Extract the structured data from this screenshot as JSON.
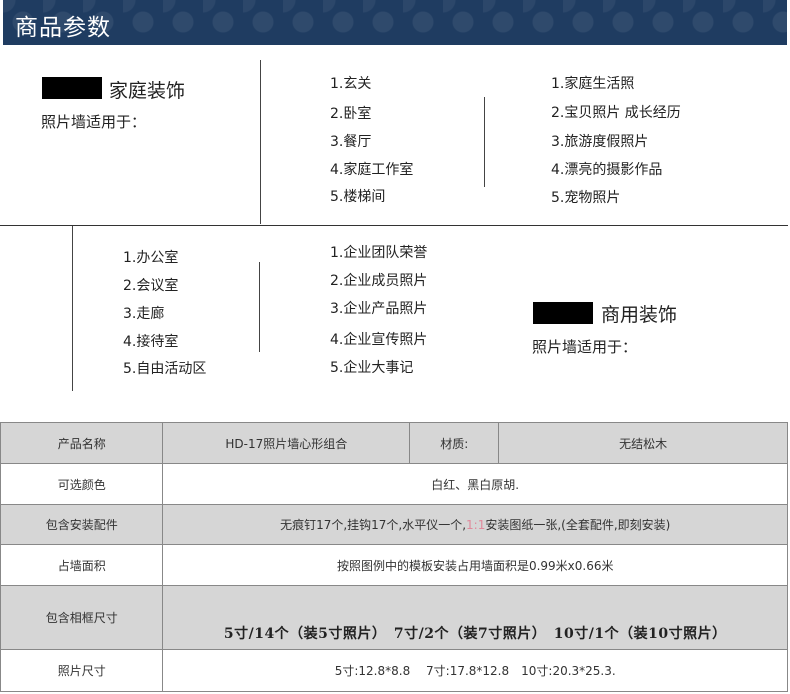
{
  "header": {
    "title": "商品参数"
  },
  "home": {
    "title": "家庭装饰",
    "subtitle": "照片墙适用于：",
    "places": [
      "1.玄关",
      "2.卧室",
      "3.餐厅",
      "4.家庭工作室",
      "5.楼梯间"
    ],
    "photos": [
      "1.家庭生活照",
      "2.宝贝照片 成长经历",
      "3.旅游度假照片",
      "4.漂亮的摄影作品",
      "5.宠物照片"
    ]
  },
  "business": {
    "title": "商用装饰",
    "subtitle": "照片墙适用于：",
    "places": [
      "1.办公室",
      "2.会议室",
      "3.走廊",
      "4.接待室",
      "5.自由活动区"
    ],
    "photos": [
      "1.企业团队荣誉",
      "2.企业成员照片",
      "3.企业产品照片",
      "4.企业宣传照片",
      "5.企业大事记"
    ]
  },
  "table": {
    "product_name_label": "产品名称",
    "product_name_value": "HD-17照片墙心形组合",
    "material_label": "材质:",
    "material_value": "无结松木",
    "color_label": "可选颜色",
    "color_value": "白红、黑白原胡.",
    "accessories_label": "包含安装配件",
    "accessories_pre": "无痕钉17个,挂钩17个,水平仪一个,",
    "accessories_highlight": "1:1",
    "accessories_post": "安装图纸一张,(全套配件,即刻安装)",
    "area_label": "占墙面积",
    "area_value": "按照图例中的模板安装占用墙面积是0.99米x0.66米",
    "frames_label": "包含相框尺寸",
    "frames_value": "5寸/14个（装5寸照片）　7寸/2个（装7寸照片）　10寸/1个（装10寸照片）",
    "photo_size_label": "照片尺寸",
    "photo_size_value": "5寸:12.8*8.8　 7寸:17.8*12.8　10寸:20.3*25.3."
  }
}
